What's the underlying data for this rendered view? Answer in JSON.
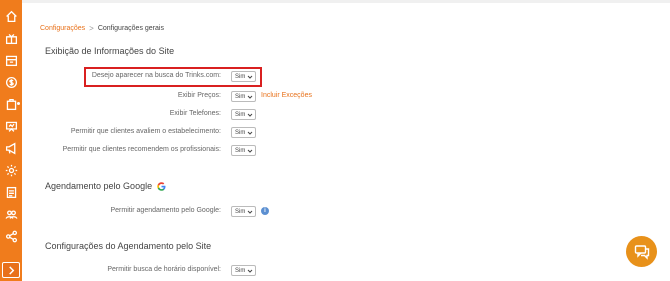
{
  "breadcrumb": {
    "root": "Configurações",
    "separator": ">",
    "current": "Configurações gerais"
  },
  "sections": {
    "site": {
      "title": "Exibição de Informações do Site"
    },
    "google": {
      "title": "Agendamento pelo Google"
    },
    "agendamento": {
      "title": "Configurações do Agendamento pelo Site"
    }
  },
  "rows": [
    {
      "label": "Desejo aparecer na busca do Trinks.com:",
      "value": "Sim"
    },
    {
      "label": "Exibir Preços:",
      "value": "Sim",
      "link": "Incluir Exceções"
    },
    {
      "label": "Exibir Telefones:",
      "value": "Sim"
    },
    {
      "label": "Permitir que clientes avaliem o estabelecimento:",
      "value": "Sim"
    },
    {
      "label": "Permitir que clientes recomendem os profissionais:",
      "value": "Sim"
    },
    {
      "label": "Permitir agendamento pelo Google:",
      "value": "Sim",
      "info": "i"
    },
    {
      "label": "Permitir busca de horário disponível:",
      "value": "Sim"
    }
  ],
  "colors": {
    "brand": "#f07c1c",
    "highlight": "#d92020",
    "info": "#5b8fd1",
    "chat": "#e8911a"
  },
  "sidebar_icons": [
    "home-icon",
    "gift-icon",
    "store-icon",
    "dollar-icon",
    "clipboard-icon",
    "presentation-icon",
    "megaphone-icon",
    "gear-icon",
    "checklist-icon",
    "users-icon",
    "share-icon",
    "chevron-right-icon"
  ]
}
